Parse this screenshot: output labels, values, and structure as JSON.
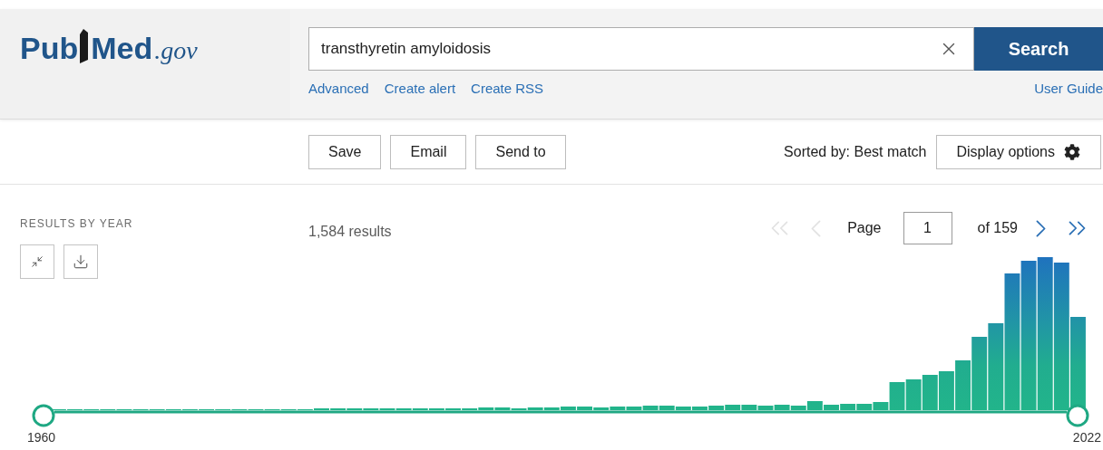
{
  "logo": {
    "left": "Pub",
    "right": "Med",
    "suffix": ".gov"
  },
  "search": {
    "value": "transthyretin amyloidosis",
    "button": "Search"
  },
  "search_links": [
    "Advanced",
    "Create alert",
    "Create RSS"
  ],
  "user_guide": "User Guide",
  "actions": [
    "Save",
    "Email",
    "Send to"
  ],
  "sort": "Sorted by: Best match",
  "display_options": "Display options",
  "results_by_year": {
    "title": "RESULTS BY YEAR",
    "start": "1960",
    "end": "2022"
  },
  "results_count": "1,584 results",
  "pagination": {
    "page_label": "Page",
    "page": "1",
    "of": "of 159",
    "nav": [
      {
        "kind": "first",
        "disabled": true
      },
      {
        "kind": "previous",
        "disabled": true
      },
      {
        "kind": "next",
        "disabled": false
      },
      {
        "kind": "last",
        "disabled": false
      }
    ]
  }
}
